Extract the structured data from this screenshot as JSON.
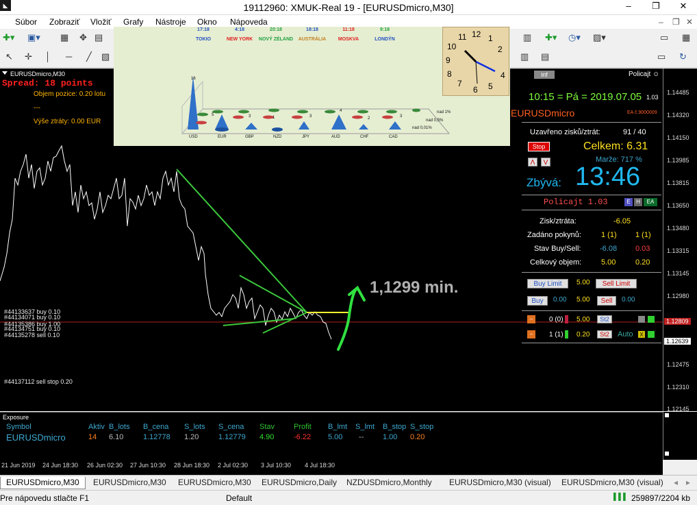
{
  "window": {
    "title": "19112960: XMUK-Real 19 - [EURUSDmicro,M30]",
    "minimize": "–",
    "maximize": "❐",
    "close": "✕"
  },
  "menu": [
    "Súbor",
    "Zobraziť",
    "Vložiť",
    "Grafy",
    "Nástroje",
    "Okno",
    "Nápoveda"
  ],
  "chart": {
    "title": "EURUSDmicro,M30",
    "spread": "Spread: 18 points",
    "objem": "Objem pozice: 0.20 lotu",
    "dashes": "---",
    "vyse": "Výše ztráty: 0.00 EUR",
    "annotation": "1,1299 min.",
    "order_labels": [
      "#44133637 buy 0.10",
      "#44134071 buy 0.10",
      "#44135386 buy 1.00",
      "#44134751 buy 0.10",
      "#44135278 sell 0.10"
    ],
    "sell_stop": "#44137112 sell stop 0.20",
    "price_labels": [
      "1.14485",
      "1.14320",
      "1.14150",
      "1.13985",
      "1.13815",
      "1.13650",
      "1.13480",
      "1.13315",
      "1.13145",
      "1.12980",
      "1.12815",
      "1.12639",
      "1.12475",
      "1.12310",
      "1.12145"
    ],
    "current_price": "1.12809",
    "time_labels": [
      "21 Jun 2019",
      "24 Jun 18:30",
      "26 Jun 02:30",
      "27 Jun 10:30",
      "28 Jun 18:30",
      "2 Jul 02:30",
      "3 Jul 10:30",
      "4 Jul 18:30"
    ]
  },
  "world": {
    "cities": [
      {
        "time": "17:18",
        "name": "TOKIO",
        "color": "#2050c0"
      },
      {
        "time": "4:18",
        "name": "NEW YORK",
        "color": "#e02020"
      },
      {
        "time": "20:18",
        "name": "NOVÝ ZÉLAND",
        "color": "#20a040"
      },
      {
        "time": "18:18",
        "name": "AUSTRÁLIA",
        "color": "#c08020"
      },
      {
        "time": "11:18",
        "name": "MOSKVA",
        "color": "#e02020"
      },
      {
        "time": "9:18",
        "name": "LONDÝN",
        "color": "#2050c0"
      }
    ],
    "currencies": [
      "USD",
      "EUR",
      "GBP",
      "NZD",
      "JPY",
      "AUD",
      "CHF",
      "CAD"
    ],
    "cone_values": [
      "16",
      "5",
      "3",
      "1",
      "3",
      "4",
      "2",
      "3"
    ],
    "legend": [
      "nad 1%",
      "nad 0,5%",
      "nad 0,01%"
    ]
  },
  "panel": {
    "inf": "inf",
    "policajt": "Policajt ☺",
    "datetime": "10:15 = Pá = 2019.07.05",
    "version": "1.03",
    "symbol": "EURUSDmicro",
    "ea": "EA č.9000009",
    "uzavreno_label": "Uzavřeno zisků/ztrát:",
    "uzavreno_val": "91 / 40",
    "stop": "Stop",
    "celkem": "Celkem: 6.31",
    "marze": "Marže: 717 %",
    "zbyva_label": "Zbývá:",
    "zbyva_val": "13:46",
    "policajt_ver": "Policajt 1.03",
    "zisk_label": "Zisk/ztráta:",
    "zisk_val": "-6.05",
    "zadano_label": "Zadáno pokynů:",
    "zadano_buy": "1 (1)",
    "zadano_sell": "1 (1)",
    "stav_label": "Stav Buy/Sell:",
    "stav_buy": "-6.08",
    "stav_sell": "0.03",
    "objem_label": "Celkový objem:",
    "objem_buy": "5.00",
    "objem_sell": "0.20",
    "buy_limit": "Buy Limit",
    "sell_limit": "Sell Limit",
    "lot1": "5.00",
    "lot2": "5.00",
    "buy": "Buy",
    "sell": "Sell",
    "buy_price": "0.00",
    "sell_price": "0.00",
    "row1_count": "0 (0)",
    "row1_val": "5.00",
    "st2": "St2",
    "row2_count": "1 (1)",
    "row2_val": "0.20",
    "auto": "Auto"
  },
  "exposure": {
    "title": "Exposure",
    "headers": [
      "Symbol",
      "Aktiv",
      "B_lots",
      "B_cena",
      "S_lots",
      "S_cena",
      "Stav",
      "Profit",
      "B_lmt",
      "S_lmt",
      "B_stop",
      "S_stop"
    ],
    "row": [
      "EURUSDmicro",
      "14",
      "6.10",
      "1.12778",
      "1.20",
      "1.12779",
      "4.90",
      "-6.22",
      "5.00",
      "--",
      "1.00",
      "0.20"
    ]
  },
  "tabs": [
    "EURUSDmicro,M30",
    "EURUSDmicro,M30",
    "EURUSDmicro,M30",
    "EURUSDmicro,Daily",
    "NZDUSDmicro,Monthly",
    "EURUSDmicro,M30 (visual)",
    "EURUSDmicro,M30 (visual)"
  ],
  "status": {
    "help": "Pre nápovedu stlačte F1",
    "profile": "Default",
    "traffic": "259897/2204 kb"
  }
}
